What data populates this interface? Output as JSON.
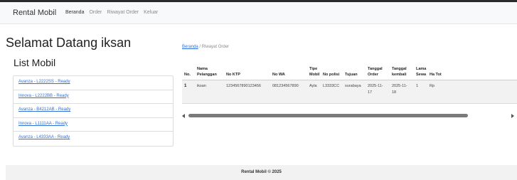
{
  "navbar": {
    "brand": "Rental Mobil",
    "items": [
      {
        "label": "Beranda",
        "active": true
      },
      {
        "label": "Order",
        "active": false
      },
      {
        "label": "Riwayat Order",
        "active": false
      },
      {
        "label": "Keluar",
        "active": false
      }
    ]
  },
  "welcome": "Selamat Datang iksan",
  "list_title": "List Mobil",
  "cars": [
    "Avanza - L2222SS - Ready",
    "Innova - L2222BB - Ready",
    "Avanza - B4212AB - Ready",
    "Innova - L1111AA - Ready",
    "Avanza - L4333AA - Ready"
  ],
  "breadcrumb": {
    "home": "Beranda",
    "separator": "/",
    "current": "Riwayat Order"
  },
  "table": {
    "headers": [
      "No.",
      "Nama Pelanggan",
      "No KTP",
      "No WA",
      "Tipe Mobil",
      "No polisi",
      "Tujuan",
      "Tanggal Order",
      "Tanggal kembali",
      "Lama Sewa",
      "Ha Tot"
    ],
    "rows": [
      [
        "1",
        "iksan",
        "1234567890123456",
        "081234567890",
        "Ayla",
        "L3333CC",
        "surabaya",
        "2025-11-17",
        "2025-11-18",
        "1",
        "Rp"
      ]
    ]
  },
  "footer": "Rental Mobil © 2025",
  "colors": {
    "link": "#2f6fd6",
    "navbar_bg": "#f8f9fa",
    "footer_bg": "#f2f2f2"
  }
}
